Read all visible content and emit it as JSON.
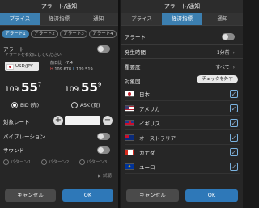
{
  "left": {
    "title": "アラート/通知",
    "tabs": [
      {
        "label": "プライス",
        "active": true
      },
      {
        "label": "経済指標",
        "active": false
      },
      {
        "label": "通知",
        "active": false
      }
    ],
    "alerts": [
      "アラート1",
      "アラート2",
      "アラート3",
      "アラート4"
    ],
    "alert_label": "アラート",
    "alert_note": "アラートを有効にしてください",
    "pair": "USD/JPY",
    "stats": {
      "change_label": "前日比",
      "change": "-7.4",
      "high_label": "H",
      "high": "109.678",
      "low_label": "L",
      "low": "109.519"
    },
    "bid": {
      "small": "109.",
      "big": "55",
      "tiny": "7",
      "label": "BID (売)"
    },
    "ask": {
      "small": "109.",
      "big": "55",
      "tiny": "9",
      "label": "ASK (買)"
    },
    "target_rate_label": "対象レート",
    "vibration_label": "バイブレーション",
    "sound_label": "サウンド",
    "patterns": [
      "パターン1",
      "パターン2",
      "パターン3"
    ],
    "play_label": "試聴",
    "cancel_label": "キャンセル",
    "ok_label": "OK"
  },
  "right": {
    "title": "アラート/通知",
    "tabs": [
      {
        "label": "プライス",
        "active": false
      },
      {
        "label": "経済指標",
        "active": true
      },
      {
        "label": "通知",
        "active": false
      }
    ],
    "alert_label": "アラート",
    "time_label": "発生時間",
    "time_value": "1分前",
    "importance_label": "重要度",
    "importance_value": "すべて",
    "country_label": "対象国",
    "uncheck_label": "チェックを外す",
    "countries": [
      {
        "name": "日本",
        "checked": true
      },
      {
        "name": "アメリカ",
        "checked": true
      },
      {
        "name": "イギリス",
        "checked": true
      },
      {
        "name": "オーストラリア",
        "checked": true
      },
      {
        "name": "カナダ",
        "checked": true
      },
      {
        "name": "ユーロ",
        "checked": true
      }
    ],
    "cancel_label": "キャンセル",
    "ok_label": "OK"
  },
  "colors": {
    "accent": "#3c7fb0",
    "ok": "#2e78b8",
    "jp_red": "#c0212c"
  }
}
